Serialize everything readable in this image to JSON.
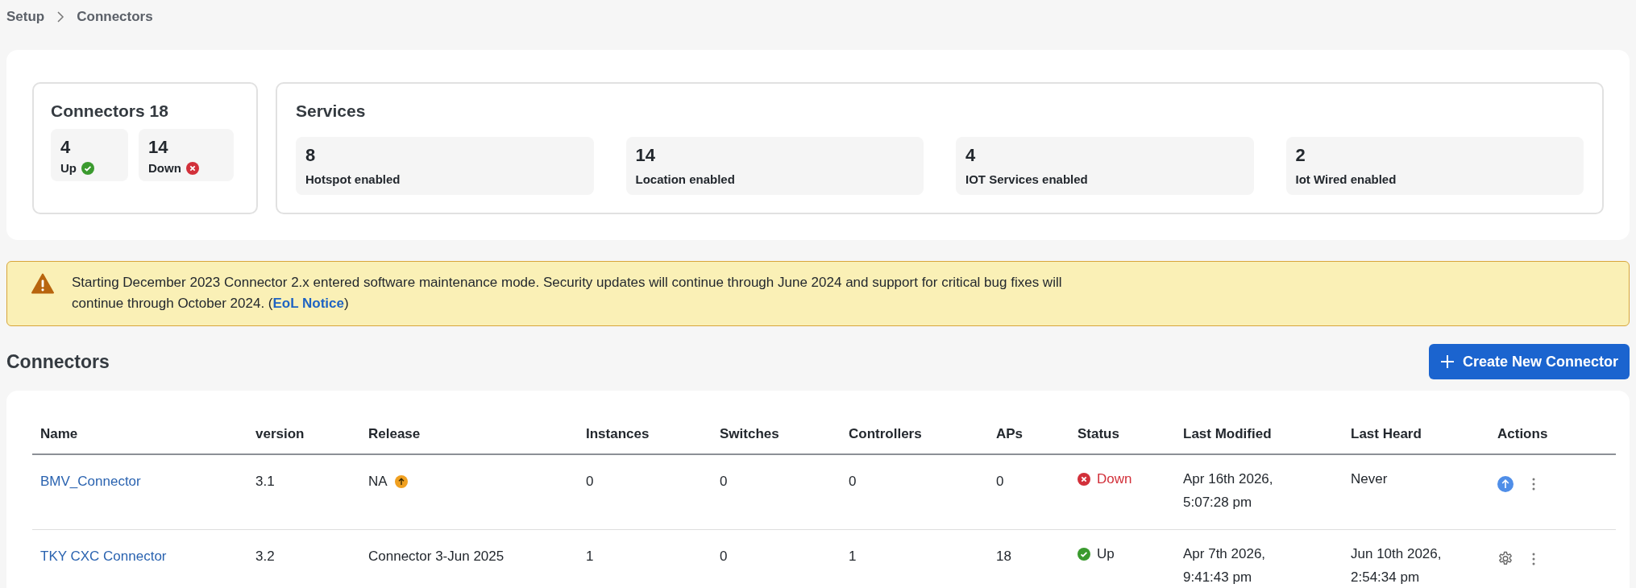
{
  "breadcrumb": {
    "items": [
      "Setup",
      "Connectors"
    ]
  },
  "summary": {
    "title": "Connectors 18",
    "counts": [
      {
        "value": "4",
        "label": "Up",
        "kind": "up"
      },
      {
        "value": "14",
        "label": "Down",
        "kind": "down"
      }
    ],
    "services_title": "Services",
    "services": [
      {
        "value": "8",
        "label": "Hotspot enabled"
      },
      {
        "value": "14",
        "label": "Location enabled"
      },
      {
        "value": "4",
        "label": "IOT Services enabled"
      },
      {
        "value": "2",
        "label": "Iot Wired enabled"
      }
    ]
  },
  "notice": {
    "text": "Starting December 2023 Connector 2.x entered software maintenance mode. Security updates will continue through June 2024 and support for critical bug fixes will continue through October 2024. (",
    "link": "EoL Notice",
    "after": ")"
  },
  "section_title": "Connectors",
  "create_button": "Create New Connector",
  "table": {
    "columns": [
      "Name",
      "version",
      "Release",
      "Instances",
      "Switches",
      "Controllers",
      "APs",
      "Status",
      "Last Modified",
      "Last Heard",
      "Actions"
    ],
    "rows": [
      {
        "name": "BMV_Connector",
        "version": "3.1",
        "release": "NA",
        "update_available": true,
        "instances": "0",
        "switches": "0",
        "controllers": "0",
        "aps": "0",
        "status": {
          "label": "Down",
          "kind": "down"
        },
        "last_modified": "Apr 16th 2026, 5:07:28 pm",
        "last_heard": "Never",
        "action": {
          "kind": "upgrade"
        }
      },
      {
        "name": "TKY CXC Connector",
        "version": "3.2",
        "release": "Connector 3-Jun 2025",
        "update_available": false,
        "instances": "1",
        "switches": "0",
        "controllers": "1",
        "aps": "18",
        "status": {
          "label": "Up",
          "kind": "up"
        },
        "last_modified": "Apr 7th 2026, 9:41:43 pm",
        "last_heard": "Jun 10th 2026, 2:54:34 pm",
        "action": {
          "kind": "settings"
        }
      }
    ]
  }
}
